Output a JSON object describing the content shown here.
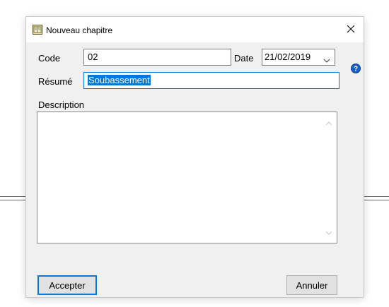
{
  "dialog": {
    "title": "Nouveau chapitre",
    "close_glyph": "×",
    "icons": {
      "title": "chapter-book-icon",
      "close": "close-icon",
      "help": "help-icon"
    }
  },
  "form": {
    "code_label": "Code",
    "code_value": "02",
    "date_label": "Date",
    "date_value": "21/02/2019",
    "resume_label": "Résumé",
    "resume_value": "Soubassement",
    "description_label": "Description",
    "description_value": ""
  },
  "buttons": {
    "accept_label": "Accepter",
    "cancel_label": "Annuler"
  },
  "colors": {
    "accent": "#0078d7",
    "window_bg": "#f0f0f0",
    "help_blue": "#1a5fc8"
  }
}
